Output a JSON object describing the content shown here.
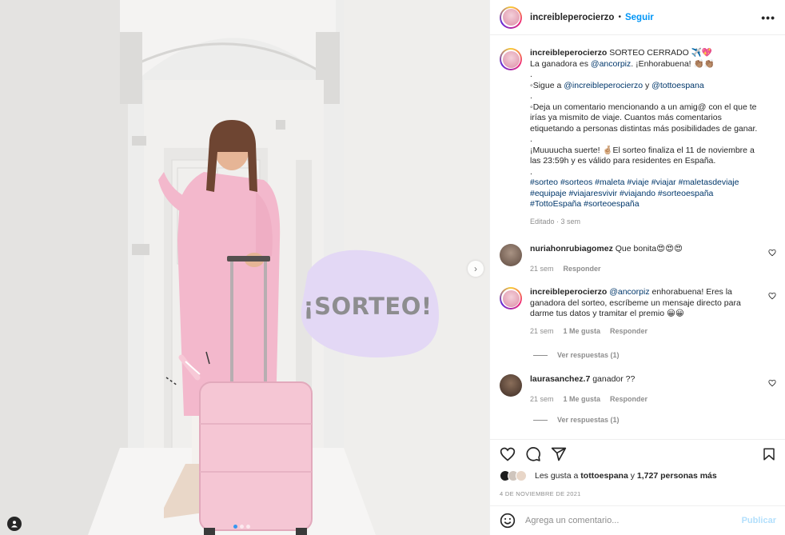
{
  "post": {
    "username": "increibleperocierzo",
    "separator": "•",
    "follow_label": "Seguir",
    "more_label": "•••",
    "image_text": "¡SORTEO!",
    "carousel": {
      "count": 3,
      "active": 1
    }
  },
  "caption": {
    "username": "increibleperocierzo",
    "title": "SORTEO CERRADO ✈️💖",
    "line1_pre": "La ganadora es ",
    "line1_mention": "@ancorpiz",
    "line1_post": ". ¡Enhorabuena! 👏🏽👏🏽",
    "dot1": ".",
    "step1_pre": "◦Sigue a ",
    "step1_m1": "@increibleperocierzo",
    "step1_mid": " y ",
    "step1_m2": "@tottoespana",
    "dot2": ".",
    "step2": "◦Deja un comentario mencionando a un amig@ con el que te irías ya mismito de viaje. Cuantos más comentarios etiquetando a personas distintas más posibilidades de ganar.",
    "dot3": ".",
    "luck": "¡Muuuucha suerte! 🤞🏼El sorteo finaliza el 11 de noviembre a las 23:59h y es válido para residentes en España.",
    "dot4": ".",
    "hashtags": "#sorteo #sorteos #maleta #viaje #viajar #maletasdeviaje #equipaje #viajaresvivir #viajando #sorteoespaña #TottoEspaña #sorteoespaña",
    "edited": "Editado",
    "time": "3 sem"
  },
  "comments": [
    {
      "username": "nuriahonrubiagomez",
      "text": "Que bonita😍😍😍",
      "time": "21 sem",
      "likes": "",
      "reply": "Responder",
      "view_replies": ""
    },
    {
      "username": "increibleperocierzo",
      "mention": "@ancorpiz",
      "text": " enhorabuena! Eres la ganadora del sorteo, escríbeme un mensaje directo para darme tus datos y tramitar el premio 😀😀",
      "time": "21 sem",
      "likes": "1 Me gusta",
      "reply": "Responder",
      "view_replies": "Ver respuestas (1)"
    },
    {
      "username": "laurasanchez.7",
      "text": "ganador ??",
      "time": "21 sem",
      "likes": "1 Me gusta",
      "reply": "Responder",
      "view_replies": "Ver respuestas (1)"
    }
  ],
  "likes": {
    "prefix": "Les gusta a ",
    "user": "tottoespana",
    "mid": " y ",
    "count": "1,727 personas más"
  },
  "date": "4 DE NOVIEMBRE DE 2021",
  "add_comment": {
    "placeholder": "Agrega un comentario...",
    "post_label": "Publicar"
  },
  "icons": {
    "more": "more-options-icon",
    "heart": "heart-icon",
    "comment": "comment-icon",
    "share": "share-icon",
    "save": "bookmark-icon",
    "emoji": "emoji-icon",
    "next": "chevron-right-icon",
    "tag": "user-tag-icon"
  }
}
